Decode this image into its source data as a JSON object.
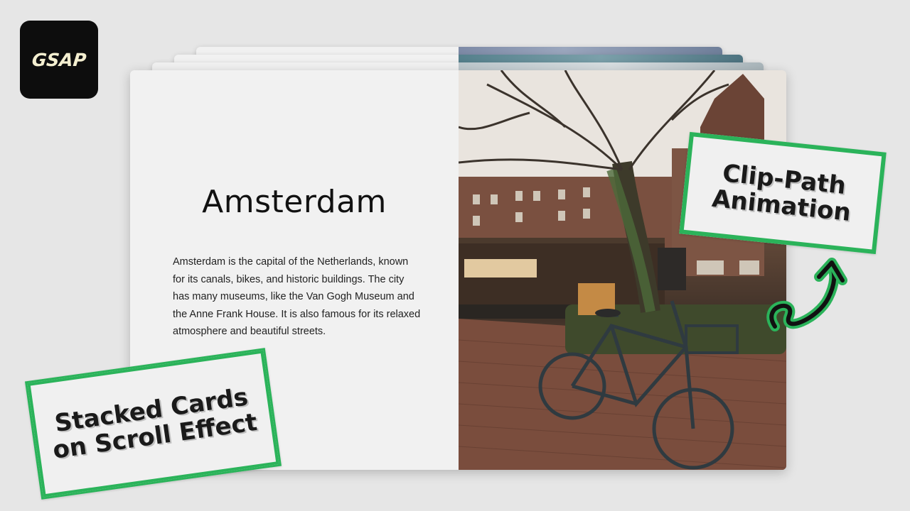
{
  "logo": {
    "text": "GSAP"
  },
  "card": {
    "title": "Amsterdam",
    "description": "Amsterdam is the capital of the Netherlands, known for its canals, bikes, and historic buildings. The city has many museums, like the Van Gogh Museum and the Anne Frank House. It is also famous for its relaxed atmosphere and beautiful streets."
  },
  "stickers": {
    "clip_path_line1": "Clip-Path",
    "clip_path_line2": "Animation",
    "stacked_line1": "Stacked Cards",
    "stacked_line2": "on Scroll Effect"
  },
  "colors": {
    "accent": "#2bb35a",
    "logo_bg": "#0d0d0d",
    "logo_text": "#f4efd0",
    "page_bg": "#e6e6e6",
    "card_bg": "#f1f1f1"
  },
  "icons": [
    "curly-arrow-icon"
  ]
}
